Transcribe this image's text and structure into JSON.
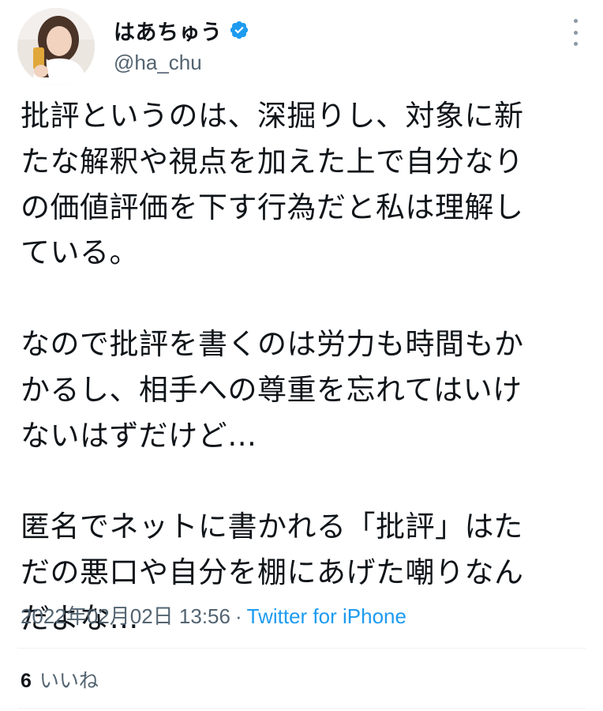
{
  "user": {
    "display_name": "はあちゅう",
    "handle": "@ha_chu",
    "verified": true
  },
  "tweet": {
    "paragraphs": [
      "批評というのは、深掘りし、対象に新\nたな解釈や視点を加えた上で自分なり\nの価値評価を下す行為だと私は理解し\nている。",
      "なので批評を書くのは労力も時間もか\nかるし、相手への尊重を忘れてはいけ\nないはずだけど…",
      "匿名でネットに書かれる「批評」はた\nだの悪口や自分を棚にあげた嘲りなん\nだよな…"
    ],
    "timestamp": "2022年02月02日 13:56",
    "separator": "·",
    "source": "Twitter for iPhone"
  },
  "stats": {
    "likes_count": "6",
    "likes_label": "いいね"
  },
  "colors": {
    "text": "#0f1419",
    "secondary": "#536471",
    "accent": "#1d9bf0",
    "divider": "#eff3f4"
  },
  "icons": {
    "verified": "verified-badge-icon",
    "more": "more-options-icon"
  }
}
